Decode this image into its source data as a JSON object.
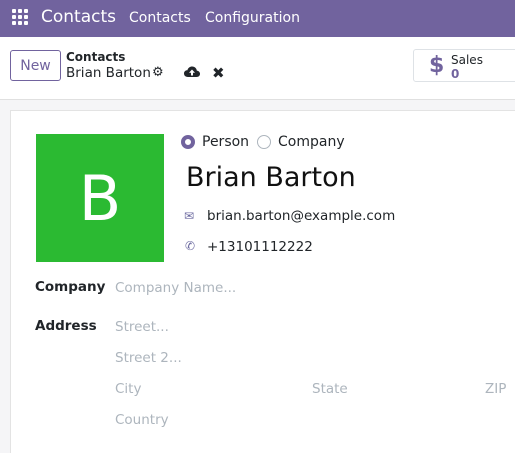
{
  "navbar": {
    "app_name": "Contacts",
    "menu": [
      "Contacts",
      "Configuration"
    ]
  },
  "control_panel": {
    "new_label": "New",
    "breadcrumb_parent": "Contacts",
    "breadcrumb_current": "Brian Barton",
    "smart_button": {
      "label": "Sales",
      "value": "0"
    }
  },
  "form": {
    "avatar_letter": "B",
    "avatar_color": "#2bba32",
    "company_type": {
      "options": [
        "Person",
        "Company"
      ],
      "selected": "Person"
    },
    "name": "Brian Barton",
    "email": "brian.barton@example.com",
    "phone": "+13101112222",
    "company_label": "Company",
    "company_placeholder": "Company Name...",
    "address_label": "Address",
    "street_placeholder": "Street...",
    "street2_placeholder": "Street 2...",
    "city_placeholder": "City",
    "state_placeholder": "State",
    "zip_placeholder": "ZIP",
    "country_placeholder": "Country"
  },
  "colors": {
    "brand": "#71639e",
    "avatar": "#2bba32"
  }
}
